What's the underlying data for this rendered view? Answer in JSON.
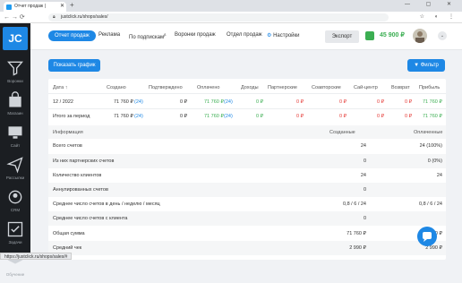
{
  "browser": {
    "tab_title": "Отчет продаж | ",
    "url": "justclick.ru/shops/sales/",
    "new_tab": "+",
    "controls": "— ▢ ✕",
    "tab_close": "✕",
    "nav_buttons": "← → ⟳"
  },
  "sidebar": {
    "logo": "JC",
    "items": [
      {
        "label": "Воронки",
        "icon": "funnel-icon"
      },
      {
        "label": "Магазин",
        "icon": "shopping-bag-icon"
      },
      {
        "label": "Сайт",
        "icon": "monitor-icon"
      },
      {
        "label": "Рассылки",
        "icon": "send-icon"
      },
      {
        "label": "CRM",
        "icon": "crm-icon"
      },
      {
        "label": "Задачи",
        "icon": "checkbox-icon"
      },
      {
        "label": "Обучение",
        "icon": "graduation-cap-icon"
      }
    ]
  },
  "topnav": {
    "tabs": [
      "Отчет продаж",
      "Реклама",
      "По подпискам",
      "Воронки продаж",
      "Отдел продаж",
      "Настройки"
    ],
    "beta_mark": "β",
    "export_label": "Экспорт",
    "balance": "45 900 ₽",
    "chevron": "⌄"
  },
  "actions": {
    "show_chart": "Показать график",
    "filter": "Фильтр"
  },
  "summary": {
    "headers": [
      "Дата",
      "Создано",
      "Подтверждено",
      "Оплачено",
      "Доходы",
      "Партнерские",
      "Соавторские",
      "Сай-центр",
      "Возврат",
      "Прибыль"
    ],
    "rows": [
      [
        "12 / 2022",
        "71 760 ₽",
        "(24)",
        "0 ₽",
        "71 760 ₽",
        "(24)",
        "0 ₽",
        "0 ₽",
        "0 ₽",
        "0 ₽",
        "0 ₽",
        "71 760 ₽"
      ],
      [
        "Итого за период",
        "71 760 ₽",
        "(24)",
        "0 ₽",
        "71 760 ₽",
        "(24)",
        "0 ₽",
        "0 ₽",
        "0 ₽",
        "0 ₽",
        "0 ₽",
        "71 760 ₽"
      ]
    ]
  },
  "info": {
    "headers": [
      "Информация",
      "Созданные",
      "Оплаченные"
    ],
    "rows": [
      [
        "Всего счетов",
        "24",
        "24 (100%)"
      ],
      [
        "Из них партнерских счетов",
        "0",
        "0 (0%)"
      ],
      [
        "Количество клиентов",
        "24",
        "24"
      ],
      [
        "Аннулированных счетов",
        "0",
        ""
      ],
      [
        "Среднее число счетов в день / неделю / месяц",
        "0,8 / 6 / 24",
        "0,8 / 6 / 24"
      ],
      [
        "Среднее число счетов с клиента",
        "0",
        ""
      ],
      [
        "Общая сумма",
        "71 760 ₽",
        "71 760 ₽"
      ],
      [
        "Средний чек",
        "2 990 ₽",
        "2 990 ₽"
      ]
    ]
  },
  "status_url": "https://justclick.ru/shops/sales/#"
}
